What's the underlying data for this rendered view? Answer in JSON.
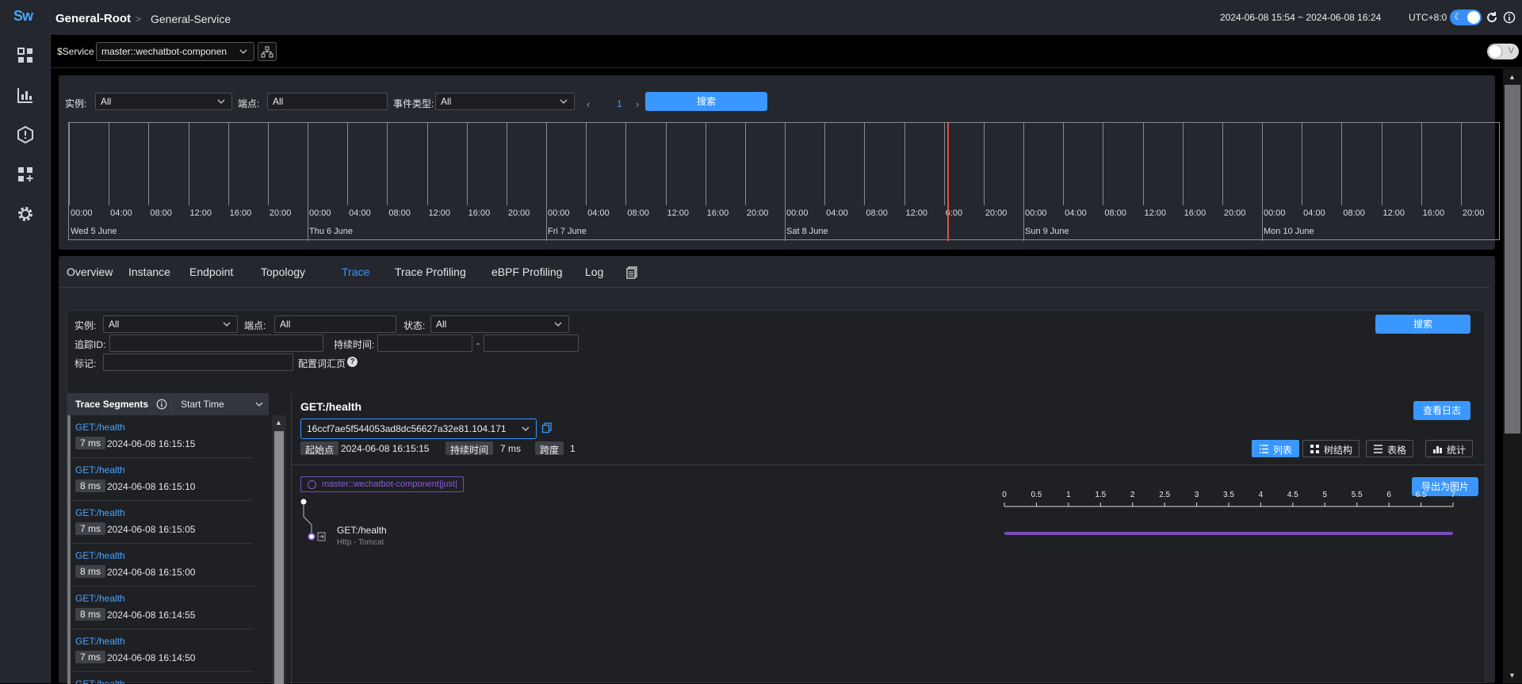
{
  "app": {
    "logo": "Sw"
  },
  "breadcrumb": {
    "root": "General-Root",
    "separator": ">",
    "service": "General-Service"
  },
  "header": {
    "time_range": "2024-06-08 15:54 ~ 2024-06-08 16:24",
    "timezone": "UTC+8:0"
  },
  "toolbar": {
    "service_label": "$Service",
    "service_value": "master::wechatbot-componen",
    "v_toggle_label": "V"
  },
  "event_filter": {
    "instance_label": "实例:",
    "instance_value": "All",
    "endpoint_label": "端点:",
    "endpoint_value": "All",
    "event_type_label": "事件类型:",
    "event_type_value": "All",
    "page": "1",
    "search_label": "搜索"
  },
  "timeline": {
    "ticks": [
      "00:00",
      "04:00",
      "08:00",
      "12:00",
      "16:00",
      "20:00",
      "00:00",
      "04:00",
      "08:00",
      "12:00",
      "16:00",
      "20:00",
      "00:00",
      "04:00",
      "08:00",
      "12:00",
      "16:00",
      "20:00",
      "00:00",
      "04:00",
      "08:00",
      "12:00",
      "6:00",
      "20:00",
      "00:00",
      "04:00",
      "08:00",
      "12:00",
      "16:00",
      "20:00",
      "00:00",
      "04:00",
      "08:00",
      "12:00",
      "16:00",
      "20:00"
    ],
    "days": [
      "Wed 5 June",
      "Thu 6 June",
      "Fri 7 June",
      "Sat 8 June",
      "Sun 9 June",
      "Mon 10 June"
    ]
  },
  "tabs": [
    "Overview",
    "Instance",
    "Endpoint",
    "Topology",
    "Trace",
    "Trace Profiling",
    "eBPF Profiling",
    "Log"
  ],
  "active_tab": "Trace",
  "trace_filter": {
    "instance_label": "实例:",
    "instance_value": "All",
    "endpoint_label": "端点:",
    "endpoint_value": "All",
    "status_label": "状态:",
    "status_value": "All",
    "trace_id_label": "追踪ID:",
    "duration_label": "持续时间:",
    "duration_sep": "-",
    "tags_label": "标记:",
    "tags_config": "配置词汇页",
    "search_label": "搜索"
  },
  "segments": {
    "title": "Trace Segments",
    "sort": "Start Time",
    "items": [
      {
        "name": "GET:/health",
        "duration": "7 ms",
        "time": "2024-06-08 16:15:15"
      },
      {
        "name": "GET:/health",
        "duration": "8 ms",
        "time": "2024-06-08 16:15:10"
      },
      {
        "name": "GET:/health",
        "duration": "7 ms",
        "time": "2024-06-08 16:15:05"
      },
      {
        "name": "GET:/health",
        "duration": "8 ms",
        "time": "2024-06-08 16:15:00"
      },
      {
        "name": "GET:/health",
        "duration": "8 ms",
        "time": "2024-06-08 16:14:55"
      },
      {
        "name": "GET:/health",
        "duration": "7 ms",
        "time": "2024-06-08 16:14:50"
      },
      {
        "name": "GET:/health",
        "duration": "",
        "time": ""
      }
    ]
  },
  "detail": {
    "title": "GET:/health",
    "trace_id": "16ccf7ae5f544053ad8dc56627a32e81.104.171",
    "start_label": "起始点",
    "start_value": "2024-06-08 16:15:15",
    "duration_label": "持续时间",
    "duration_value": "7 ms",
    "depth_label": "跨度",
    "depth_value": "1",
    "view_logs": "查看日志",
    "views": [
      "列表",
      "树结构",
      "表格",
      "统计"
    ],
    "active_view": "列表",
    "service_chip": "master::wechatbot-component|just|",
    "export": "导出为图片",
    "span": {
      "name": "GET:/health",
      "component": "Http - Tomcat",
      "start": 0,
      "end": 7
    },
    "axis_ticks": [
      "0",
      "0.5",
      "1",
      "1.5",
      "2",
      "2.5",
      "3",
      "3.5",
      "4",
      "4.5",
      "5",
      "5.5",
      "6",
      "6.5",
      "7"
    ]
  },
  "colors": {
    "accent": "#3a97ff",
    "span": "#7a4ab8",
    "marker": "#d9534f"
  }
}
